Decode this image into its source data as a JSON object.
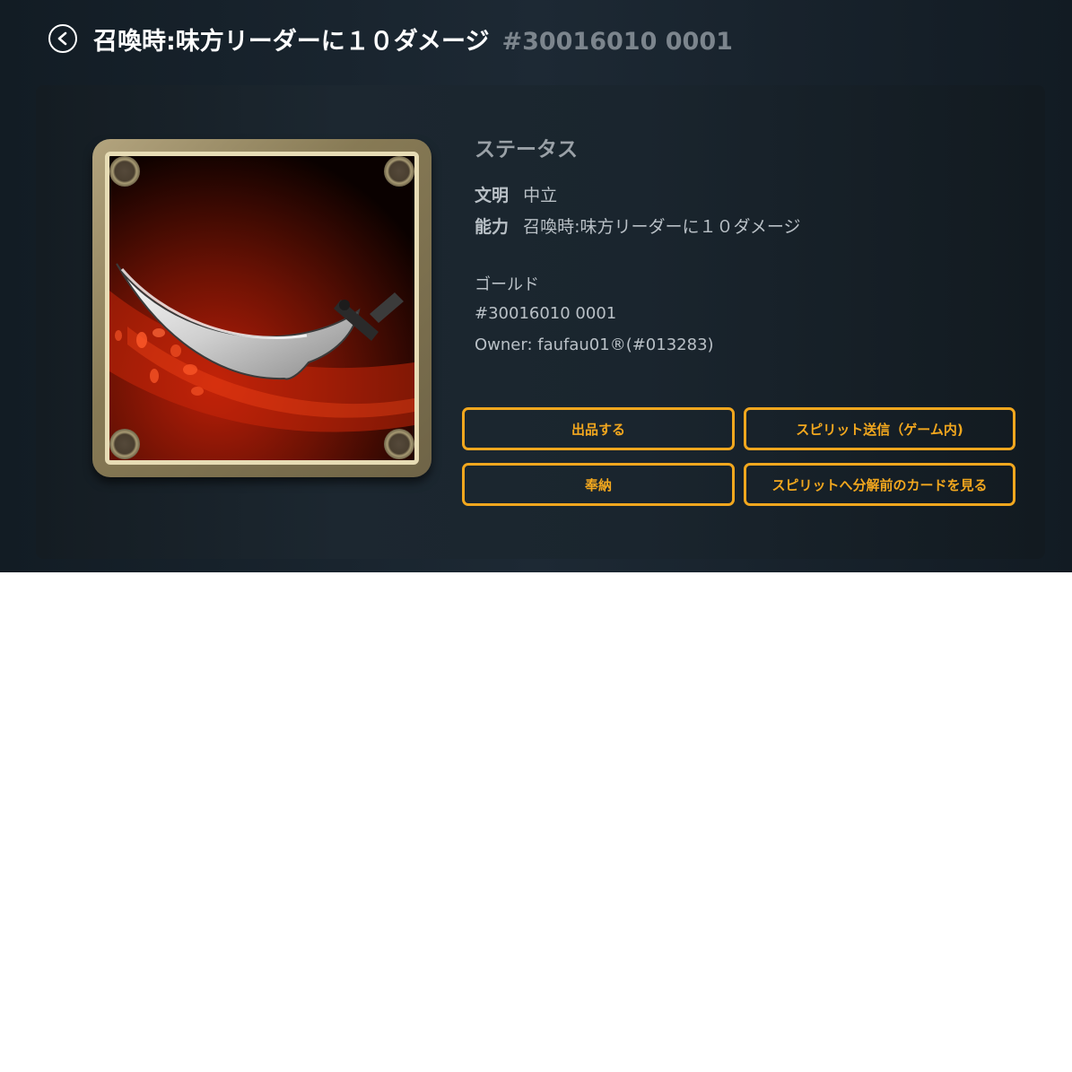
{
  "header": {
    "back_icon": "chevron-left-icon",
    "title": "召喚時:味方リーダーに１０ダメージ",
    "serial": "#30016010 0001"
  },
  "card": {
    "art": "scimitar-sword-on-red-background",
    "frame_color": "#877a55",
    "accent_red": "#b81e08"
  },
  "status": {
    "heading": "ステータス",
    "attributes": [
      {
        "key": "文明",
        "value": "中立"
      },
      {
        "key": "能力",
        "value": "召喚時:味方リーダーに１０ダメージ"
      }
    ],
    "rarity": "ゴールド",
    "serial": "#30016010 0001",
    "owner": "Owner: faufau01®(#013283)"
  },
  "actions": {
    "list": "出品する",
    "send_spirit": "スピリット送信（ゲーム内)",
    "offer": "奉納",
    "view_card": "スピリットへ分解前のカードを見る"
  },
  "colors": {
    "accent": "#f2a71e",
    "background_dark": "#17212a",
    "text_muted": "#b9c0c6"
  }
}
